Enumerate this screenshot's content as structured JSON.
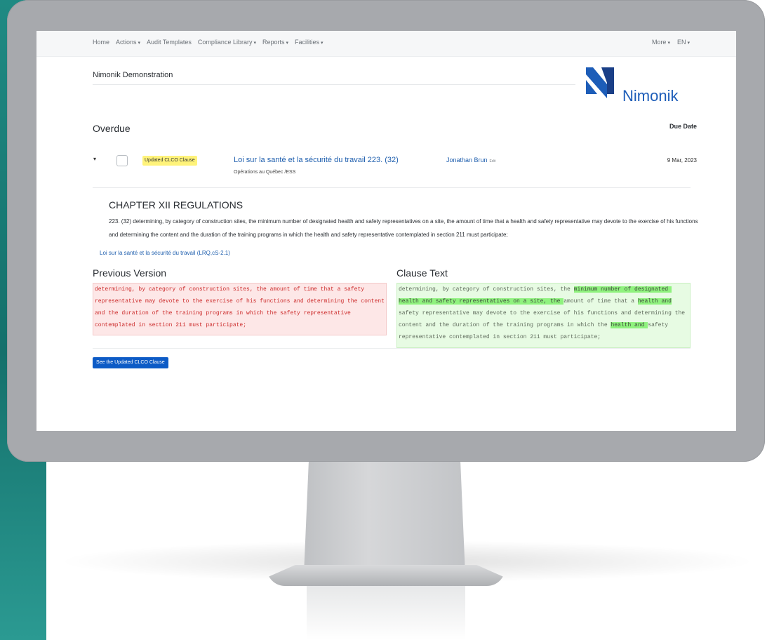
{
  "nav": {
    "items": [
      {
        "label": "Home",
        "dropdown": false
      },
      {
        "label": "Actions",
        "dropdown": true
      },
      {
        "label": "Audit Templates",
        "dropdown": false
      },
      {
        "label": "Compliance Library",
        "dropdown": true
      },
      {
        "label": "Reports",
        "dropdown": true
      },
      {
        "label": "Facilities",
        "dropdown": true
      }
    ],
    "more": "More",
    "language": "EN"
  },
  "org": {
    "name": "Nimonik Demonstration"
  },
  "logo": {
    "text": "Nimonik",
    "color": "#1d5db8"
  },
  "section": {
    "title": "Overdue",
    "due_header": "Due Date"
  },
  "row": {
    "badge": "Updated CLCO Clause",
    "title": "Loi sur la santé et la sécurité du travail 223. (32)",
    "subtitle": "Opérations au Québec /ESS",
    "assignee": "Jonathan Brun",
    "edit": "Edit",
    "due_date": "9 Mar, 2023"
  },
  "chapter": {
    "title": "CHAPTER XII REGULATIONS",
    "text": "223. (32) determining, by category of construction sites, the minimum number of designated health and safety representatives on a site, the amount of time that a health and safety representative may devote to the exercise of his functions and determining the content and the duration of the training programs in which the health and safety representative contemplated in section 211 must participate;",
    "link": "Loi sur la santé et la sécurité du travail (LRQ,cS-2.1)"
  },
  "previous": {
    "title": "Previous Version",
    "text": "determining, by category of construction sites, the amount of time that a safety representative may devote to the exercise of his functions and determining the content and the duration of the training programs in which the safety representative contemplated in section 211 must participate;"
  },
  "clause": {
    "title": "Clause Text",
    "parts": [
      {
        "text": "determining, by category of construction sites, the ",
        "hl": false
      },
      {
        "text": "minimum number of designated health and safety representatives on a site, the ",
        "hl": true
      },
      {
        "text": "amount of time that a ",
        "hl": false
      },
      {
        "text": "health and",
        "hl": true
      },
      {
        "text": " safety representative may devote to the exercise of his functions and determining the content and the duration of the training programs in which the ",
        "hl": false
      },
      {
        "text": "health and ",
        "hl": true
      },
      {
        "text": "safety representative contemplated in section 211 must participate;",
        "hl": false
      }
    ]
  },
  "action_button": "See the Updated CLCO Clause",
  "colors": {
    "link": "#1f5fae",
    "badge": "#fff37a",
    "removed_bg": "#fde7e7",
    "removed_text": "#cc2b2b",
    "added_bg": "#e7fbe3",
    "added_highlight": "#8ff27e",
    "button": "#0d5bc6"
  }
}
